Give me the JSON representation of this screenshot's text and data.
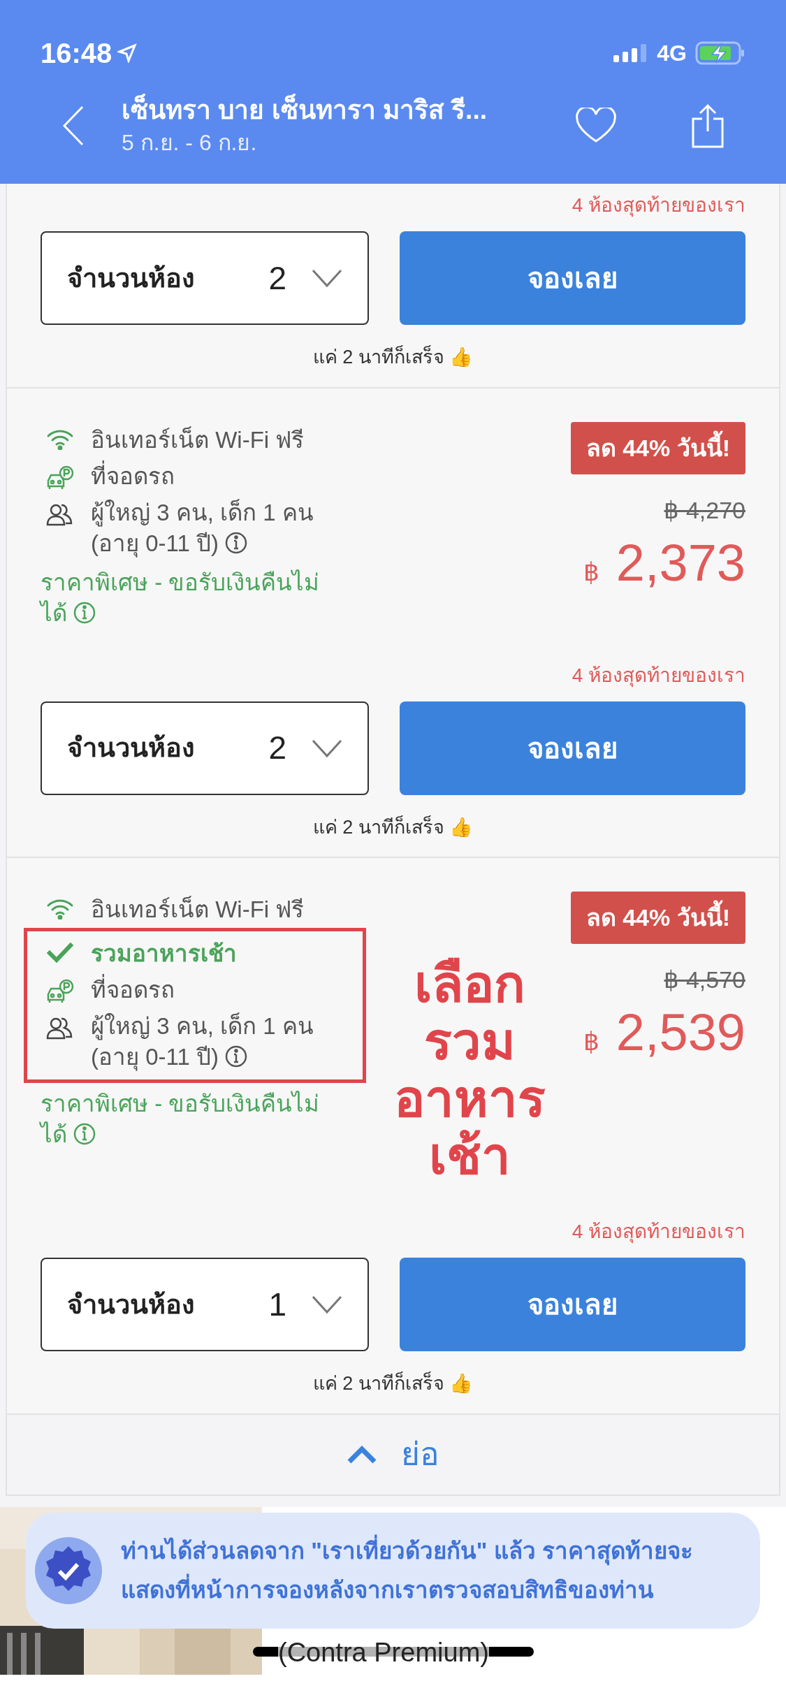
{
  "status_bar": {
    "time": "16:48",
    "network": "4G"
  },
  "header": {
    "title": "เซ็นทรา บาย เซ็นทารา มาริส รี...",
    "dates": "5 ก.ย. - 6 ก.ย."
  },
  "offers": [
    {
      "remaining": "4 ห้องสุดท้ายของเรา",
      "rooms_label": "จำนวนห้อง",
      "rooms_value": "2",
      "book": "จองเลย",
      "speed_note": "แค่ 2 นาทีก็เสร็จ 👍"
    },
    {
      "features": [
        {
          "kind": "wifi",
          "text": "อินเทอร์เน็ต Wi-Fi ฟรี",
          "highlighted": false
        },
        {
          "kind": "parking",
          "text": "ที่จอดรถ",
          "highlighted": false
        },
        {
          "kind": "guests",
          "text": "ผู้ใหญ่ 3 คน, เด็ก 1 คน (อายุ 0-11 ปี)",
          "highlighted": false
        }
      ],
      "policy": "ราคาพิเศษ - ขอรับเงินคืนไม่ได้",
      "badge": "ลด 44% วันนี้!",
      "original_price": "฿ 4,270",
      "currency": "฿",
      "price": "2,373",
      "remaining": "4 ห้องสุดท้ายของเรา",
      "rooms_label": "จำนวนห้อง",
      "rooms_value": "2",
      "book": "จองเลย",
      "speed_note": "แค่ 2 นาทีก็เสร็จ 👍"
    },
    {
      "features": [
        {
          "kind": "wifi",
          "text": "อินเทอร์เน็ต Wi-Fi ฟรี",
          "highlighted": false
        },
        {
          "kind": "breakfast",
          "text": "รวมอาหารเช้า",
          "highlighted": true
        },
        {
          "kind": "parking",
          "text": "ที่จอดรถ",
          "highlighted": true
        },
        {
          "kind": "guests",
          "text": "ผู้ใหญ่ 3 คน, เด็ก 1 คน (อายุ 0-11 ปี)",
          "highlighted": true
        }
      ],
      "policy": "ราคาพิเศษ - ขอรับเงินคืนไม่ได้",
      "annotation": [
        "เลือก",
        "รวม",
        "อาหาร",
        "เช้า"
      ],
      "badge": "ลด 44% วันนี้!",
      "original_price": "฿ 4,570",
      "currency": "฿",
      "price": "2,539",
      "remaining": "4 ห้องสุดท้ายของเรา",
      "rooms_label": "จำนวนห้อง",
      "rooms_value": "1",
      "book": "จองเลย",
      "speed_note": "แค่ 2 นาทีก็เสร็จ 👍"
    }
  ],
  "collapse": "ย่อ",
  "banner": "ท่านได้ส่วนลดจาก \"เราเที่ยวด้วยกัน\" แล้ว ราคาสุดท้ายจะแสดงที่หน้าการจองหลังจากเราตรวจสอบสิทธิของท่าน",
  "below": {
    "caption": "(Contra Premium)"
  }
}
